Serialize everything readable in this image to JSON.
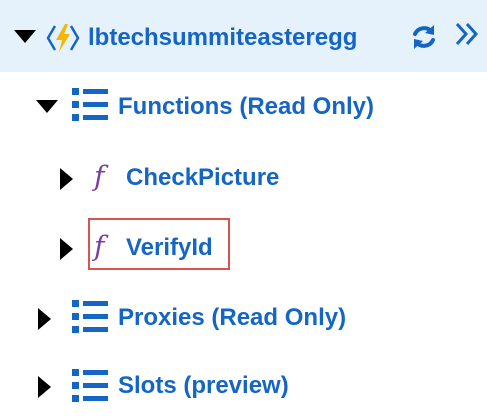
{
  "tree": {
    "root": {
      "label": "lbtechsummiteasteregg",
      "icon": "function-app-icon",
      "expanded": true,
      "actions": [
        {
          "name": "refresh-icon",
          "title": "Refresh"
        },
        {
          "name": "collapse-panel-icon",
          "title": "Collapse"
        }
      ]
    },
    "functions_group": {
      "label": "Functions (Read Only)",
      "icon": "list-icon",
      "expanded": true,
      "items": [
        {
          "label": "CheckPicture",
          "icon": "function-f-icon",
          "selected": false
        },
        {
          "label": "VerifyId",
          "icon": "function-f-icon",
          "selected": true
        }
      ]
    },
    "proxies_group": {
      "label": "Proxies (Read Only)",
      "icon": "list-icon",
      "expanded": false
    },
    "slots_group": {
      "label": "Slots (preview)",
      "icon": "list-icon",
      "expanded": false
    }
  },
  "colors": {
    "accent": "#1566c4",
    "root_row_bg": "#e5f1fb",
    "function_icon": "#7a3fa3",
    "lightning": "#f5b800",
    "selection_border": "#d9534f",
    "caret": "#000000"
  }
}
